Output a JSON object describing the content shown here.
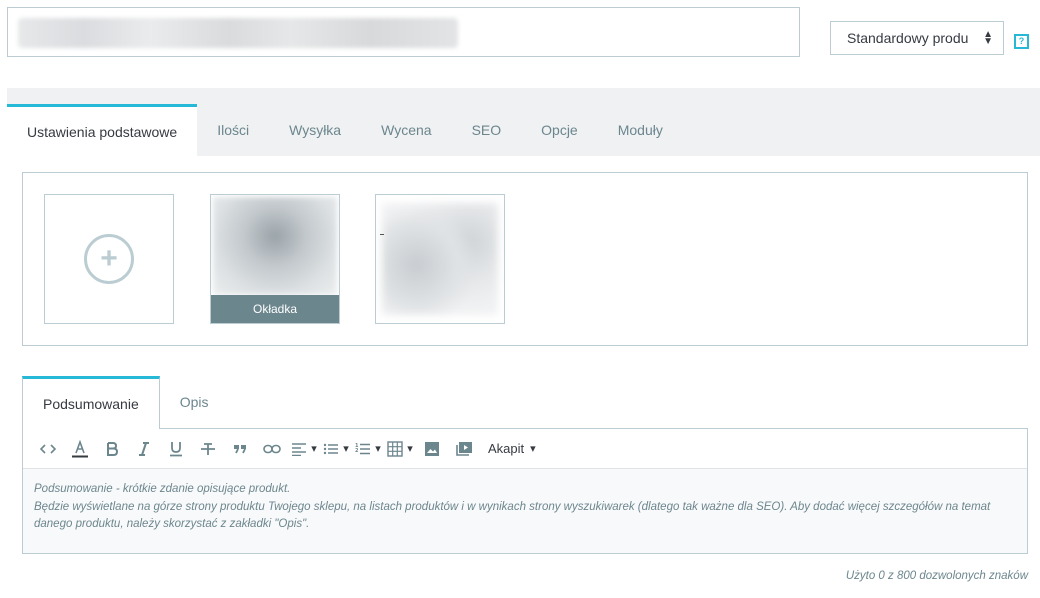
{
  "header": {
    "product_type": "Standardowy produ",
    "help_label": "?"
  },
  "tabs": [
    {
      "label": "Ustawienia podstawowe"
    },
    {
      "label": "Ilości"
    },
    {
      "label": "Wysyłka"
    },
    {
      "label": "Wycena"
    },
    {
      "label": "SEO"
    },
    {
      "label": "Opcje"
    },
    {
      "label": "Moduły"
    }
  ],
  "images": {
    "add_symbol": "+",
    "cover_label": "Okładka"
  },
  "desc_tabs": [
    {
      "label": "Podsumowanie"
    },
    {
      "label": "Opis"
    }
  ],
  "toolbar": {
    "paragraph_label": "Akapit"
  },
  "editor": {
    "placeholder_line1": "Podsumowanie - krótkie zdanie opisujące produkt.",
    "placeholder_line2": "Będzie wyświetlane na górze strony produktu Twojego sklepu, na listach produktów i w wynikach strony wyszukiwarek (dlatego tak ważne dla SEO). Aby dodać więcej szczegółów na temat danego produktu, należy skorzystać z zakładki \"Opis\"."
  },
  "counter": "Użyto 0 z 800 dozwolonych znaków",
  "colors": {
    "accent": "#25b9d7",
    "border": "#bbcdd2",
    "muted_text": "#6c868e",
    "panel_bg": "#eff1f2"
  }
}
